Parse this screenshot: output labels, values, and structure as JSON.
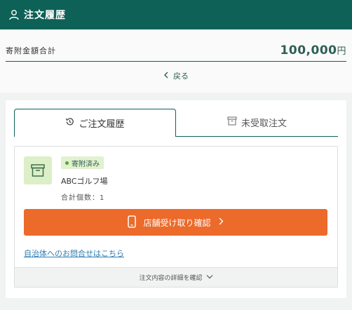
{
  "header": {
    "title": "注文履歴",
    "icon": "user-icon"
  },
  "summary": {
    "total_label": "寄附金額合計",
    "total_amount": "100,000",
    "currency": "円",
    "back_label": "戻る"
  },
  "tabs": [
    {
      "label": "ご注文履歴",
      "icon": "history-icon",
      "active": true
    },
    {
      "label": "未受取注文",
      "icon": "box-icon",
      "active": false
    }
  ],
  "order": {
    "status": "寄附済み",
    "facility": "ABCゴルフ場",
    "quantity_label": "合計個数：",
    "quantity": "1",
    "confirm_button": "店舗受け取り確認",
    "contact_link": "自治体へのお問合せはこちら",
    "details_label": "注文内容の詳細を確認"
  },
  "colors": {
    "header_bg": "#0e6156",
    "accent_green": "#2e5f55",
    "button_orange": "#ec6a2a",
    "badge_bg": "#e2f1cf",
    "link_blue": "#2f7db5"
  }
}
